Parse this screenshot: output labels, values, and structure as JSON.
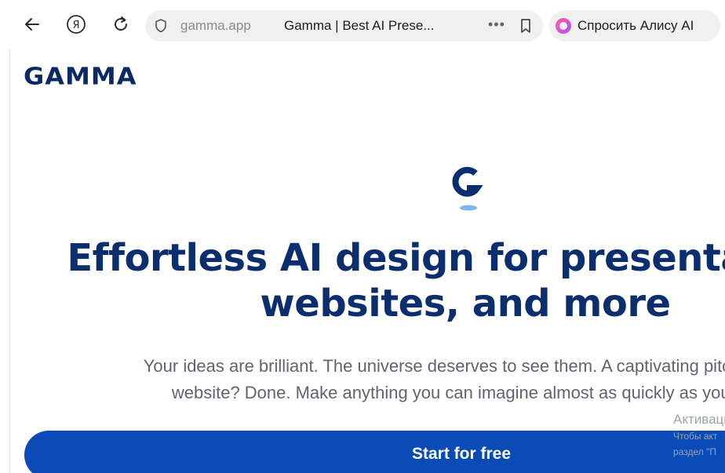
{
  "browser": {
    "address_domain": "gamma.app",
    "tab_title": "Gamma | Best AI Prese...",
    "more_label": "•••",
    "alice_label": "Спросить Алису AI"
  },
  "page": {
    "logo": "GAMMA",
    "headline_line1": "Effortless AI design for presentations,",
    "headline_line2": "websites, and more",
    "subtitle_line1": "Your ideas are brilliant. The universe deserves to see them. A captivating pitch deck?",
    "subtitle_line2": "website? Done. Make anything you can imagine almost as quickly as you can",
    "cta_label": "Start for free"
  },
  "watermark": {
    "title": "Активация",
    "line1": "Чтобы акт",
    "line2": "раздел \"П"
  },
  "colors": {
    "brand_navy": "#0b2f6e",
    "cta_blue": "#0a4bb8",
    "accent_light_blue": "#7fb2f0"
  }
}
